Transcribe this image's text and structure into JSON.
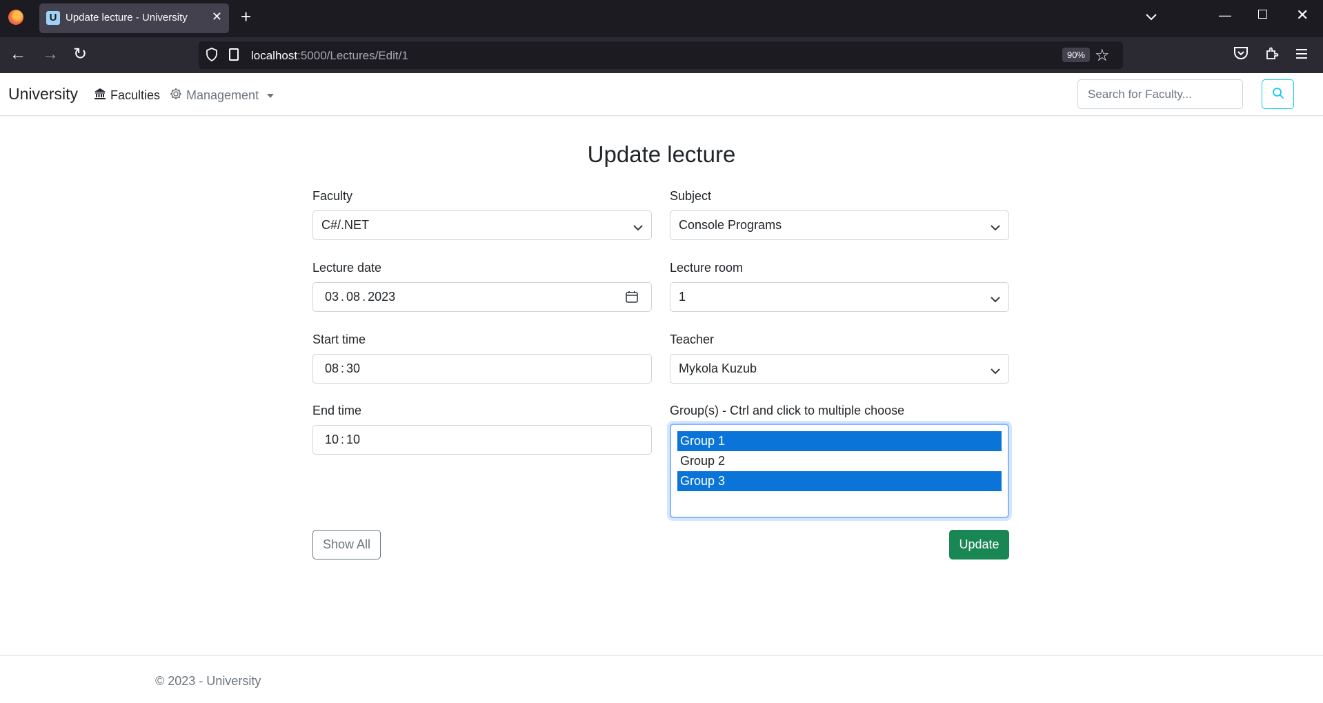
{
  "browser": {
    "tab_favicon": "U",
    "tab_title": "Update lecture - University",
    "url_host": "localhost",
    "url_rest": ":5000/Lectures/Edit/1",
    "zoom": "90%"
  },
  "app": {
    "brand": "University",
    "nav": {
      "faculties": "Faculties",
      "management": "Management"
    },
    "search_placeholder": "Search for Faculty..."
  },
  "form": {
    "title": "Update lecture",
    "faculty": {
      "label": "Faculty",
      "value": "C#/.NET"
    },
    "subject": {
      "label": "Subject",
      "value": "Console Programs"
    },
    "lecture_date": {
      "label": "Lecture date",
      "day": "03",
      "month": "08",
      "year": "2023"
    },
    "lecture_room": {
      "label": "Lecture room",
      "value": "1"
    },
    "start_time": {
      "label": "Start time",
      "hour": "08",
      "minute": "30"
    },
    "teacher": {
      "label": "Teacher",
      "value": "Mykola Kuzub"
    },
    "end_time": {
      "label": "End time",
      "hour": "10",
      "minute": "10"
    },
    "groups": {
      "label": "Group(s) - Ctrl and click to multiple choose",
      "options": [
        {
          "label": "Group 1",
          "selected": true
        },
        {
          "label": "Group 2",
          "selected": false
        },
        {
          "label": "Group 3",
          "selected": true
        }
      ]
    },
    "show_all_label": "Show All",
    "update_label": "Update"
  },
  "footer": {
    "text": "© 2023 - University"
  }
}
